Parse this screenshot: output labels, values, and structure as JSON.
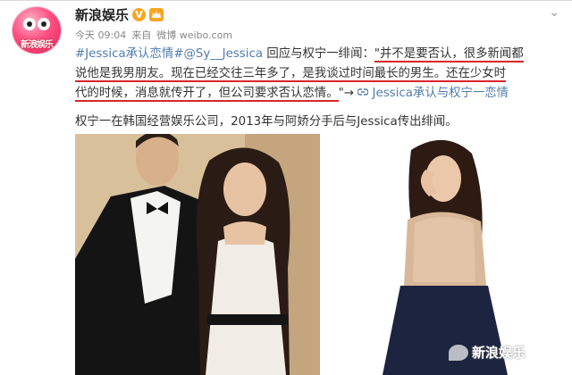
{
  "account": {
    "name": "新浪娱乐",
    "avatar_text": "新浪娱乐",
    "time": "今天 09:04",
    "source_prefix": "来自",
    "source": "微博 weibo.com"
  },
  "post": {
    "hashtag": "#Jessica承认恋情#",
    "mention": "@Sy__Jessica",
    "intro": " 回应与权宁一绯闻：",
    "quote_line1": "\"并不是要否认，很多新闻都",
    "quote_line2a": "说他是我男朋友。现在已经交往三年多了，是我谈过时间最长的男生。",
    "quote_line2b": "还在少女时",
    "quote_line3": "代的时候，消息就传开了，但公司要求否认恋情。",
    "quote_end": "\"→ ",
    "link_icon": "link-icon",
    "link_text": "Jessica承认与权宁一恋情",
    "summary": "权宁一在韩国经营娱乐公司，2013年与阿娇分手后与Jessica传出绯闻。"
  },
  "watermark": {
    "text": "新浪娱乐"
  },
  "colors": {
    "link": "#507daf",
    "underline": "#d9252b",
    "brand": "#e1245e"
  }
}
